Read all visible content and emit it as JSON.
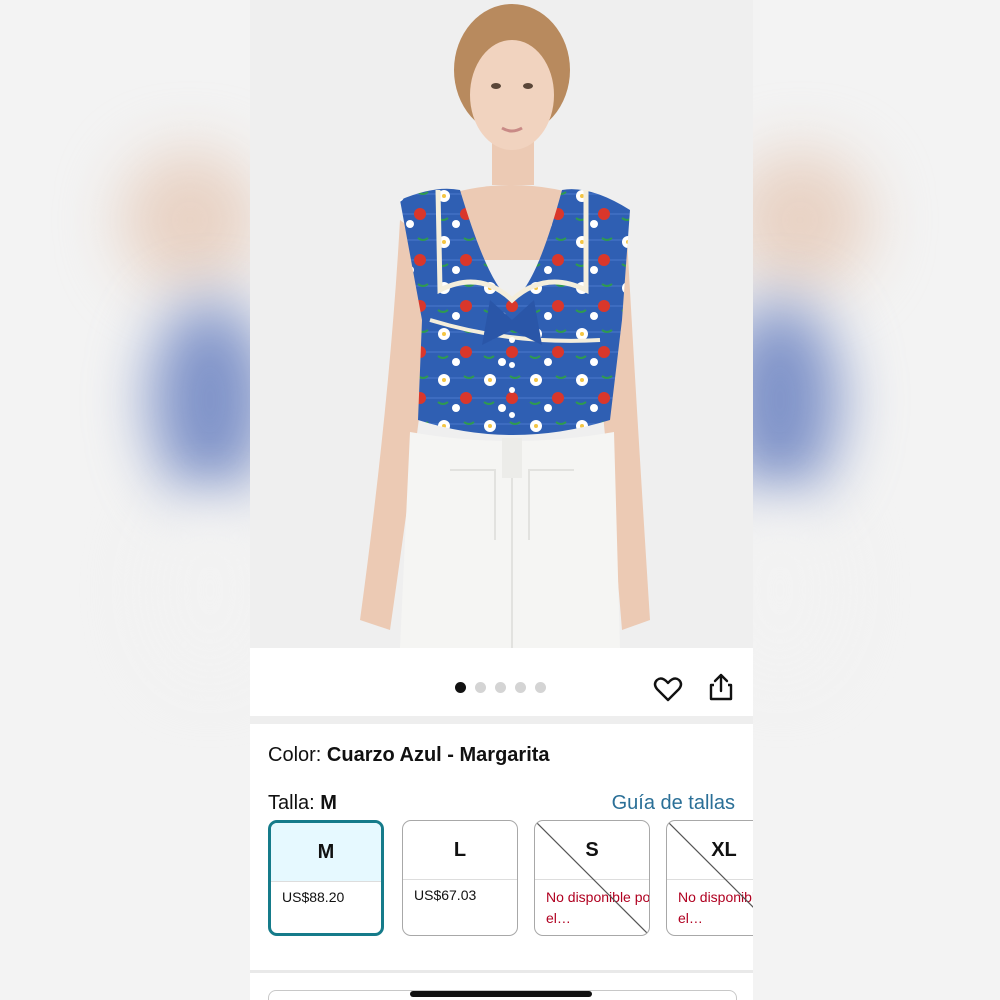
{
  "gallery": {
    "dot_count": 5,
    "active_index": 0,
    "favorite_icon": "heart-icon",
    "share_icon": "share-icon"
  },
  "color": {
    "label": "Color:",
    "value": "Cuarzo Azul - Margarita"
  },
  "size": {
    "label": "Talla:",
    "value": "M",
    "guide_link": "Guía de tallas",
    "options": [
      {
        "size": "M",
        "price": "US$88.20",
        "selected": true,
        "available": true
      },
      {
        "size": "L",
        "price": "US$67.03",
        "selected": false,
        "available": true
      },
      {
        "size": "S",
        "note": "No disponible por el…",
        "selected": false,
        "available": false
      },
      {
        "size": "XL",
        "note": "No disponible por el…",
        "selected": false,
        "available": false
      }
    ]
  },
  "colors": {
    "accent_link": "#2a6f97",
    "selected_border": "#157b8a",
    "selected_fill": "#e6f9ff",
    "unavailable_text": "#b00020"
  }
}
